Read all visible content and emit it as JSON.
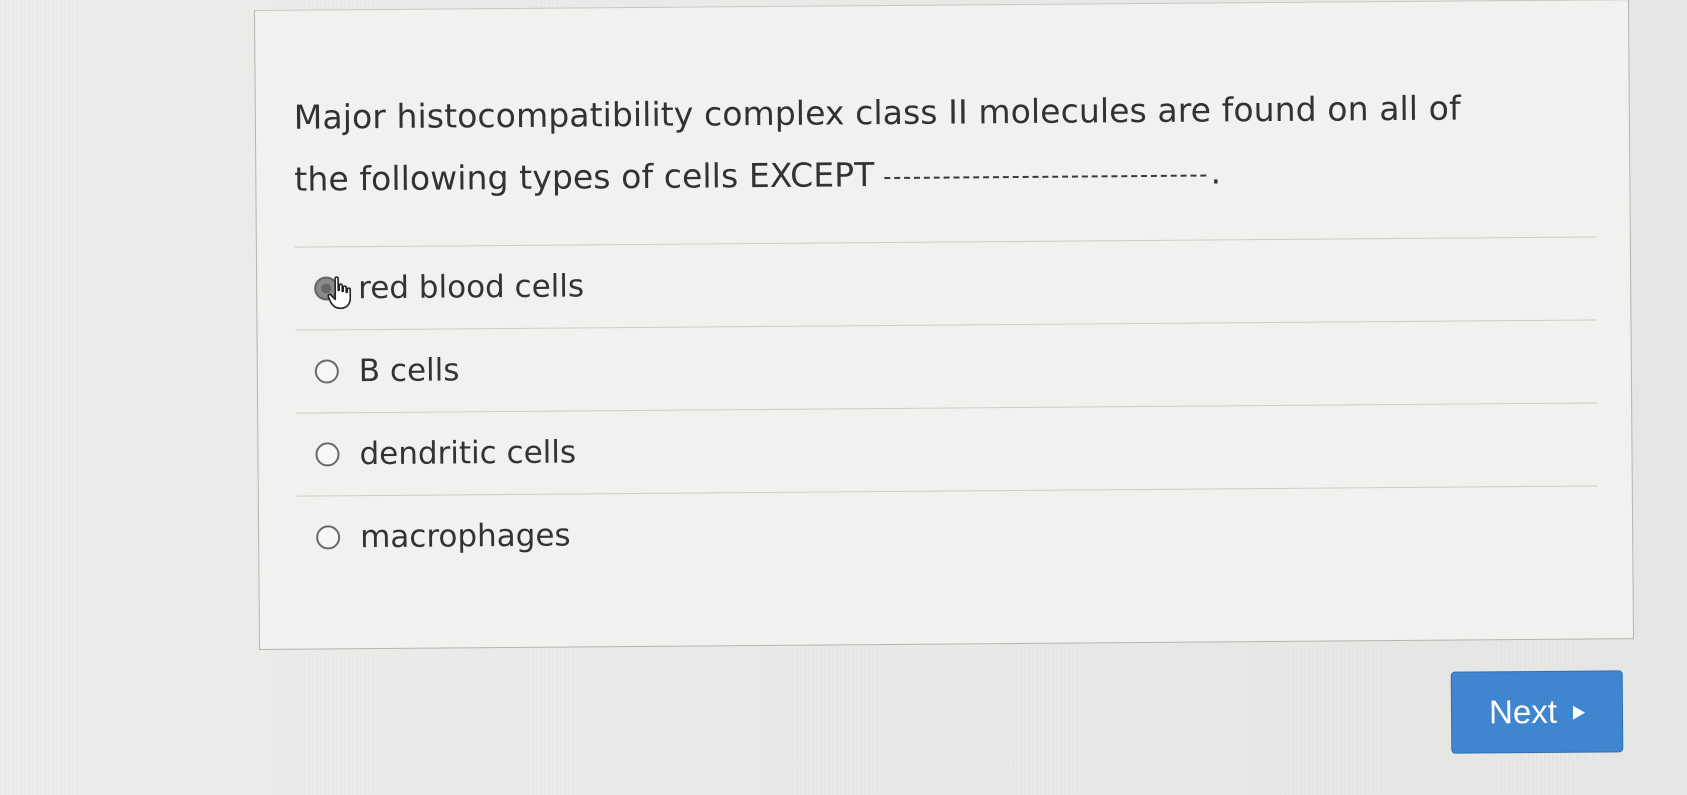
{
  "question": {
    "text_before_blank": "Major histocompatibility complex class II molecules are found on all of the following types of cells EXCEPT",
    "text_after_blank": "."
  },
  "options": [
    {
      "label": "red blood cells",
      "selected": true
    },
    {
      "label": "B cells",
      "selected": false
    },
    {
      "label": "dendritic cells",
      "selected": false
    },
    {
      "label": "macrophages",
      "selected": false
    }
  ],
  "navigation": {
    "next_label": "Next",
    "next_icon": "right-triangle-icon"
  },
  "colors": {
    "button_bg": "#3f86cf",
    "page_bg": "#e9e9e8",
    "card_bg": "#f1f1ef"
  }
}
